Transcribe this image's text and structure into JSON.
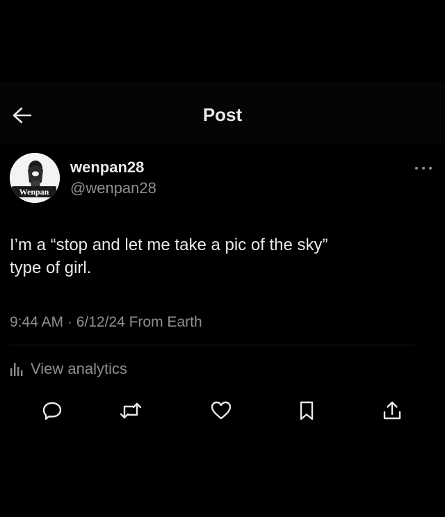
{
  "header": {
    "title": "Post",
    "back_icon": "arrow-left-icon"
  },
  "author": {
    "display_name": "wenpan28",
    "handle": "@wenpan28",
    "avatar_label": "Wenpan"
  },
  "post": {
    "lines": [
      "I’m a “stop and let me take a pic of the sky”",
      "type of girl."
    ],
    "meta": "9:44 AM · 6/12/24 From Earth"
  },
  "analytics": {
    "label": "View analytics",
    "icon": "bar-chart-icon"
  },
  "actions": [
    {
      "name": "reply",
      "icon": "reply-icon"
    },
    {
      "name": "repost",
      "icon": "repost-icon"
    },
    {
      "name": "like",
      "icon": "heart-icon"
    },
    {
      "name": "bookmark",
      "icon": "bookmark-icon"
    },
    {
      "name": "share",
      "icon": "share-icon"
    }
  ],
  "colors": {
    "background": "#000000",
    "text": "#e7e9ea",
    "muted": "#8b8f94"
  }
}
